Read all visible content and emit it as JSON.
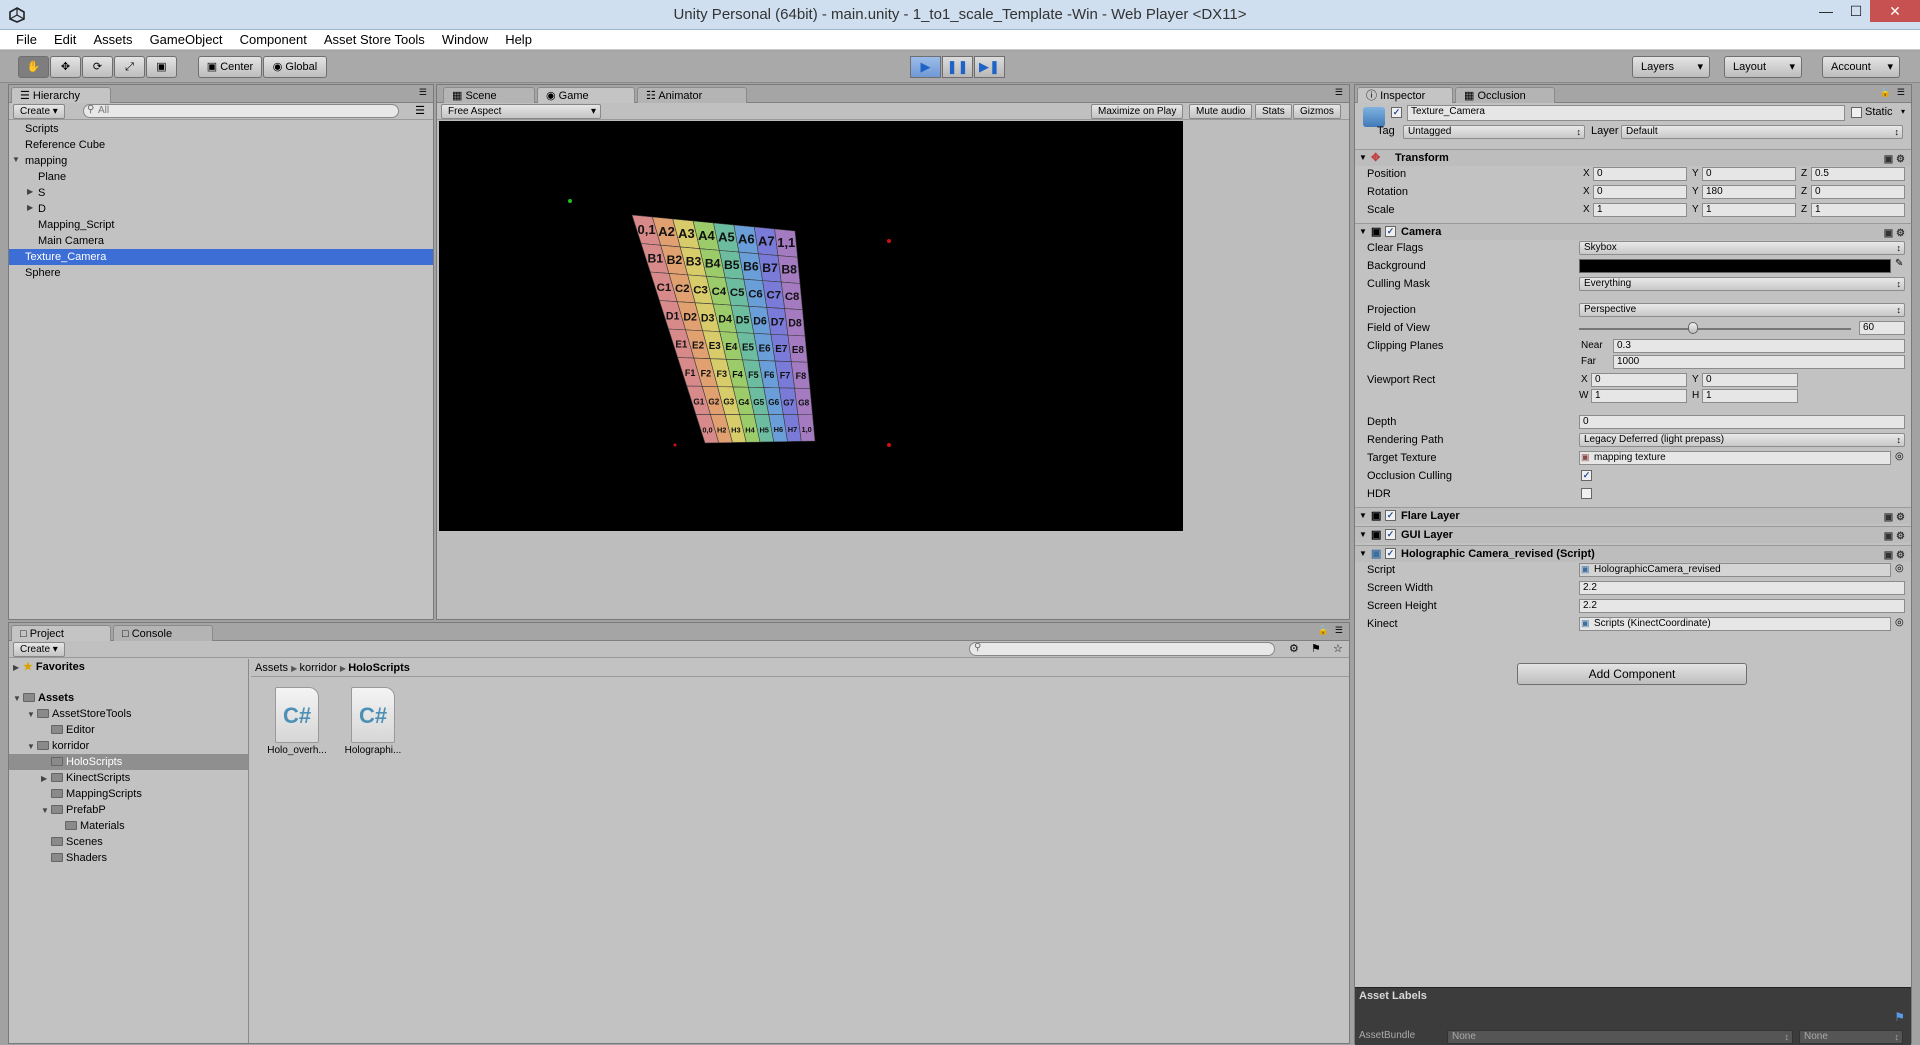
{
  "window": {
    "title": "Unity Personal (64bit) - main.unity - 1_to1_scale_Template -Win - Web Player <DX11>",
    "minimize": "—",
    "maximize": "☐",
    "close": "✕"
  },
  "menu": [
    "File",
    "Edit",
    "Assets",
    "GameObject",
    "Component",
    "Asset Store Tools",
    "Window",
    "Help"
  ],
  "toolbar": {
    "pivot": "Center",
    "space": "Global",
    "layers": "Layers",
    "layout": "Layout",
    "account": "Account"
  },
  "hierarchy": {
    "tab": "Hierarchy",
    "create": "Create",
    "search_placeholder": "All",
    "items": [
      "Scripts",
      "Reference Cube",
      "mapping",
      "Plane",
      "S",
      "D",
      "Mapping_Script",
      "Main Camera",
      "Texture_Camera",
      "Sphere"
    ]
  },
  "game": {
    "tabs": [
      "Scene",
      "Game",
      "Animator"
    ],
    "aspect": "Free Aspect",
    "options": [
      "Maximize on Play",
      "Mute audio",
      "Stats",
      "Gizmos"
    ],
    "grid_rows": [
      [
        "0,1",
        "A2",
        "A3",
        "A4",
        "A5",
        "A6",
        "A7",
        "1,1"
      ],
      [
        "B1",
        "B2",
        "B3",
        "B4",
        "B5",
        "B6",
        "B7",
        "B8"
      ],
      [
        "C1",
        "C2",
        "C3",
        "C4",
        "C5",
        "C6",
        "C7",
        "C8"
      ],
      [
        "D1",
        "D2",
        "D3",
        "D4",
        "D5",
        "D6",
        "D7",
        "D8"
      ],
      [
        "E1",
        "E2",
        "E3",
        "E4",
        "E5",
        "E6",
        "E7",
        "E8"
      ],
      [
        "F1",
        "F2",
        "F3",
        "F4",
        "F5",
        "F6",
        "F7",
        "F8"
      ],
      [
        "G1",
        "G2",
        "G3",
        "G4",
        "G5",
        "G6",
        "G7",
        "G8"
      ],
      [
        "0,0",
        "H2",
        "H3",
        "H4",
        "H5",
        "H6",
        "H7",
        "1,0"
      ]
    ],
    "column_colors": [
      "#d88a8a",
      "#e0a070",
      "#d8cc6a",
      "#9ccc6a",
      "#6cbca0",
      "#6a9ed8",
      "#7a7ad8",
      "#a47ac0"
    ]
  },
  "project": {
    "tabs": [
      "Project",
      "Console"
    ],
    "create": "Create",
    "favorites": "Favorites",
    "assets": "Assets",
    "tree": [
      "AssetStoreTools",
      "Editor",
      "korridor",
      "HoloScripts",
      "KinectScripts",
      "MappingScripts",
      "PrefabP",
      "Materials",
      "Scenes",
      "Shaders"
    ],
    "breadcrumb": [
      "Assets",
      "korridor",
      "HoloScripts"
    ],
    "files": [
      {
        "name": "Holo_overh...",
        "glyph": "C#"
      },
      {
        "name": "Holographi...",
        "glyph": "C#"
      }
    ]
  },
  "inspector": {
    "tabs": [
      "Inspector",
      "Occlusion"
    ],
    "object_name": "Texture_Camera",
    "static_label": "Static",
    "tag_label": "Tag",
    "tag_value": "Untagged",
    "layer_label": "Layer",
    "layer_value": "Default",
    "transform": {
      "title": "Transform",
      "position_label": "Position",
      "rotation_label": "Rotation",
      "scale_label": "Scale",
      "position": [
        "0",
        "0",
        "0.5"
      ],
      "rotation": [
        "0",
        "180",
        "0"
      ],
      "scale": [
        "1",
        "1",
        "1"
      ]
    },
    "camera": {
      "title": "Camera",
      "clear_flags_label": "Clear Flags",
      "clear_flags": "Skybox",
      "background_label": "Background",
      "culling_mask_label": "Culling Mask",
      "culling_mask": "Everything",
      "projection_label": "Projection",
      "projection": "Perspective",
      "fov_label": "Field of View",
      "fov": "60",
      "fov_fraction": 0.42,
      "clipping_label": "Clipping Planes",
      "near_label": "Near",
      "near": "0.3",
      "far_label": "Far",
      "far": "1000",
      "viewport_label": "Viewport Rect",
      "vx": "0",
      "vy": "0",
      "vw": "1",
      "vh": "1",
      "depth_label": "Depth",
      "depth": "0",
      "rendering_path_label": "Rendering Path",
      "rendering_path": "Legacy Deferred (light prepass)",
      "target_texture_label": "Target Texture",
      "target_texture": "mapping texture",
      "occlusion_label": "Occlusion Culling",
      "hdr_label": "HDR"
    },
    "flare_layer": "Flare Layer",
    "gui_layer": "GUI Layer",
    "holo": {
      "title": "Holographic Camera_revised (Script)",
      "script_label": "Script",
      "script": "HolographicCamera_revised",
      "screen_width_label": "Screen Width",
      "screen_width": "2.2",
      "screen_height_label": "Screen Height",
      "screen_height": "2.2",
      "kinect_label": "Kinect",
      "kinect": "Scripts (KinectCoordinate)"
    },
    "add_component": "Add Component",
    "asset_labels": "Asset Labels",
    "asset_bundle": "AssetBundle",
    "asset_bundle_value": "None",
    "asset_bundle_variant": "None"
  }
}
